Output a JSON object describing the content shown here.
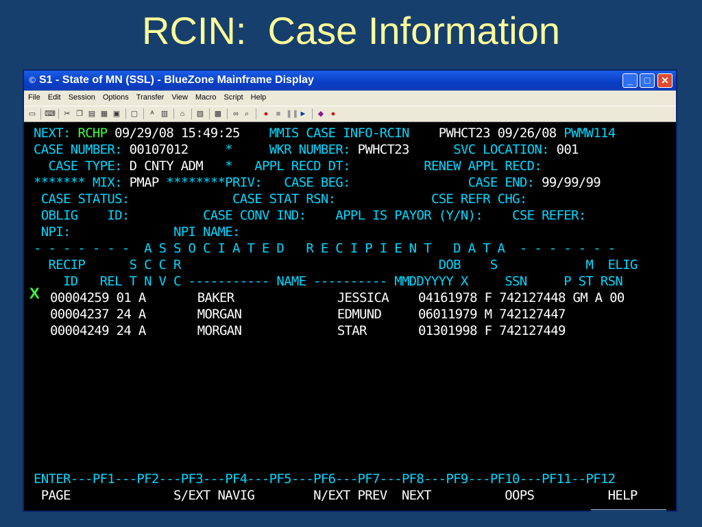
{
  "slide": {
    "title": "RCIN:  Case Information"
  },
  "window": {
    "title": "S1 - State of MN (SSL) - BlueZone Mainframe Display",
    "controls": {
      "minimize": "_",
      "maximize": "□",
      "close": "✕"
    },
    "menu": [
      "File",
      "Edit",
      "Session",
      "Options",
      "Transfer",
      "View",
      "Macro",
      "Script",
      "Help"
    ]
  },
  "screen": {
    "header": {
      "next_label": "NEXT:",
      "next_value": "RCHP",
      "datetime": "09/29/08 15:49:25",
      "screen_title": "MMIS CASE INFO-RCIN",
      "user_date": "PWHCT23 09/26/08",
      "terminal_id": "PWMW114"
    },
    "line1": {
      "case_number_label": "CASE NUMBER:",
      "case_number": "00107012",
      "star": "*",
      "wkr_label": "WKR NUMBER:",
      "wkr_value": "PWHCT23",
      "svc_label": "SVC LOCATION:",
      "svc_value": "001"
    },
    "line2": {
      "case_type_label": "CASE TYPE:",
      "case_type": "D CNTY ADM",
      "star": "*",
      "appl_recd_label": "APPL RECD DT:",
      "renew_label": "RENEW APPL RECD:"
    },
    "line3": {
      "stars_left": "*******",
      "mix_label": "MIX:",
      "mix_value": "PMAP",
      "stars_right": "********",
      "priv_label": "PRIV:",
      "case_beg_label": "CASE BEG:",
      "case_end_label": "CASE END:",
      "case_end_value": "99/99/99"
    },
    "line4": {
      "case_status_label": "CASE STATUS:",
      "stat_rsn_label": "CASE STAT RSN:",
      "refr_chg_label": "CSE REFR CHG:"
    },
    "line5": {
      "oblig_label": "OBLIG",
      "id_label": "ID:",
      "conv_label": "CASE CONV IND:",
      "payor_label": "APPL IS PAYOR (Y/N):",
      "refer_label": "CSE REFER:"
    },
    "line6": {
      "npi_label": "NPI:",
      "npi_name_label": "NPI NAME:"
    },
    "section_banner": "- - - - - - -  A S S O C I A T E D   R E C I P I E N T   D A T A  - - - - - - -",
    "col_header1": "  RECIP      S C C R                                   DOB    S            M  ELIG",
    "col_header2": "    ID   REL T N V C ----------- NAME ---------- MMDDYYYY X     SSN     P ST RSN",
    "selection_mark": "X",
    "recipients": [
      "00004259 01 A       BAKER              JESSICA    04161978 F 742127448 GM A 00",
      "00004237 24 A       MORGAN             EDMUND     06011979 M 742127447",
      "00004249 24 A       MORGAN             STAR       01301998 F 742127449"
    ],
    "pf_keys": "ENTER---PF1---PF2---PF3---PF4---PF5---PF6---PF7---PF8---PF9---PF10---PF11--PF12",
    "pf_labels": " PAGE              S/EXT NAVIG        N/EXT PREV  NEXT          OOPS          HELP"
  }
}
